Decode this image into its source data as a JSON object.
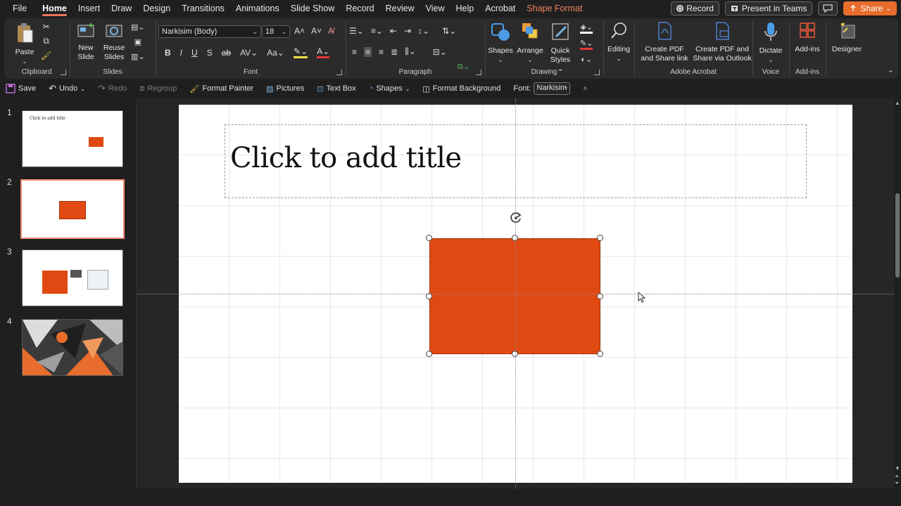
{
  "menu": {
    "tabs": [
      "File",
      "Home",
      "Insert",
      "Draw",
      "Design",
      "Transitions",
      "Animations",
      "Slide Show",
      "Record",
      "Review",
      "View",
      "Help",
      "Acrobat",
      "Shape Format"
    ],
    "active": "Home",
    "record_label": "Record",
    "present_teams_label": "Present in Teams",
    "share_label": "Share"
  },
  "ribbon": {
    "clipboard": {
      "paste": "Paste",
      "label": "Clipboard"
    },
    "slides": {
      "new_slide_line1": "New",
      "new_slide_line2": "Slide",
      "reuse_line1": "Reuse",
      "reuse_line2": "Slides",
      "label": "Slides"
    },
    "font": {
      "family": "Narkisim (Body)",
      "size": "18",
      "label": "Font"
    },
    "paragraph": {
      "label": "Paragraph"
    },
    "drawing": {
      "shapes": "Shapes",
      "arrange": "Arrange",
      "quick_line1": "Quick",
      "quick_line2": "Styles",
      "label": "Drawing"
    },
    "editing": {
      "label": "Editing"
    },
    "acrobat": {
      "create_pdf_line1": "Create PDF",
      "create_pdf_line2": "and Share link",
      "create_pdf_outlook_line1": "Create PDF and",
      "create_pdf_outlook_line2": "Share via Outlook",
      "label": "Adobe Acrobat"
    },
    "voice": {
      "dictate": "Dictate",
      "label": "Voice"
    },
    "addins": {
      "addins": "Add-ins",
      "label": "Add-ins"
    },
    "designer": {
      "designer": "Designer"
    }
  },
  "qat": {
    "save": "Save",
    "undo": "Undo",
    "redo": "Redo",
    "regroup": "Regroup",
    "format_painter": "Format Painter",
    "pictures": "Pictures",
    "text_box": "Text Box",
    "shapes": "Shapes",
    "format_background": "Format Background",
    "font_label": "Font:",
    "font_value": "Narkisim"
  },
  "slides_panel": {
    "numbers": [
      "1",
      "2",
      "3",
      "4"
    ],
    "thumb1_title": "Click to add title",
    "selected": "2"
  },
  "slide": {
    "title_placeholder": "Click to add title",
    "shape_color": "#e04a12"
  },
  "colors": {
    "accent": "#f0745a",
    "share": "#e86c2c",
    "shape_format_tab": "#f0855f"
  }
}
